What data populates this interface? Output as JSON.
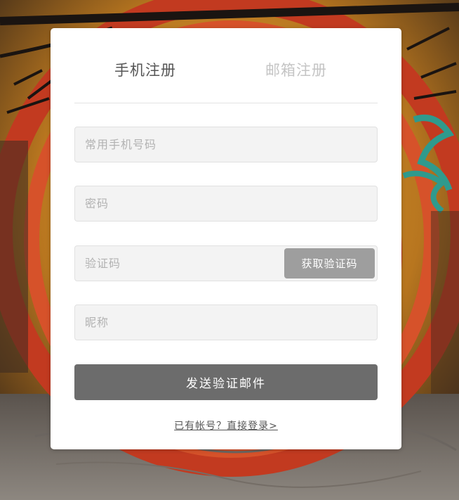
{
  "tabs": {
    "phone_label": "手机注册",
    "email_label": "邮箱注册"
  },
  "form": {
    "phone_placeholder": "常用手机号码",
    "password_placeholder": "密码",
    "code_placeholder": "验证码",
    "get_code_label": "获取验证码",
    "nickname_placeholder": "昵称",
    "submit_label": "发送验证邮件"
  },
  "footer": {
    "login_link": "已有帐号？直接登录>"
  },
  "colors": {
    "card_bg": "#ffffff",
    "input_bg": "#f3f3f3",
    "code_button": "#9e9e9e",
    "submit_button": "#6c6c6c",
    "active_tab": "#555555",
    "inactive_tab": "#c4c4c4"
  }
}
